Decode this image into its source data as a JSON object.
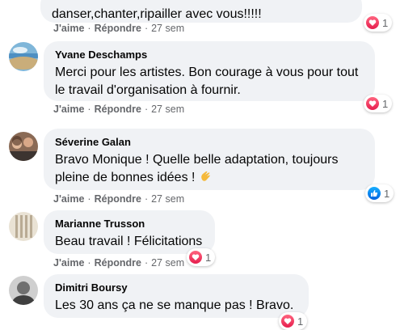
{
  "comments": [
    {
      "text": "danser,chanter,ripailler avec vous!!!!!",
      "like": "J'aime",
      "reply": "Répondre",
      "sep": "·",
      "time": "27 sem",
      "reaction": {
        "type": "love",
        "count": "1"
      }
    },
    {
      "author": "Yvane Deschamps",
      "text": "Merci pour les artistes. Bon courage à vous pour tout\nle travail d'organisation à fournir.",
      "like": "J'aime",
      "reply": "Répondre",
      "sep": "·",
      "time": "27 sem",
      "reaction": {
        "type": "love",
        "count": "1"
      }
    },
    {
      "author": "Séverine Galan",
      "text": "Bravo Monique ! Quelle belle adaptation, toujours\npleine de bonnes idées ! ",
      "emoji": "clapping-hands",
      "like": "J'aime",
      "reply": "Répondre",
      "sep": "·",
      "time": "27 sem",
      "reaction": {
        "type": "like",
        "count": "1"
      }
    },
    {
      "author": "Marianne Trusson",
      "text": "Beau travail ! Félicitations",
      "like": "J'aime",
      "reply": "Répondre",
      "sep": "·",
      "time": "27 sem",
      "reaction": {
        "type": "love",
        "count": "1"
      }
    },
    {
      "author": "Dimitri Boursy",
      "text": "Les 30 ans ça ne se manque pas ! Bravo.",
      "reaction": {
        "type": "love",
        "count": "1"
      }
    }
  ],
  "colors": {
    "bubble": "#f0f2f5",
    "meta": "#65676b",
    "love": "#f33e58",
    "like": "#1877f2"
  }
}
